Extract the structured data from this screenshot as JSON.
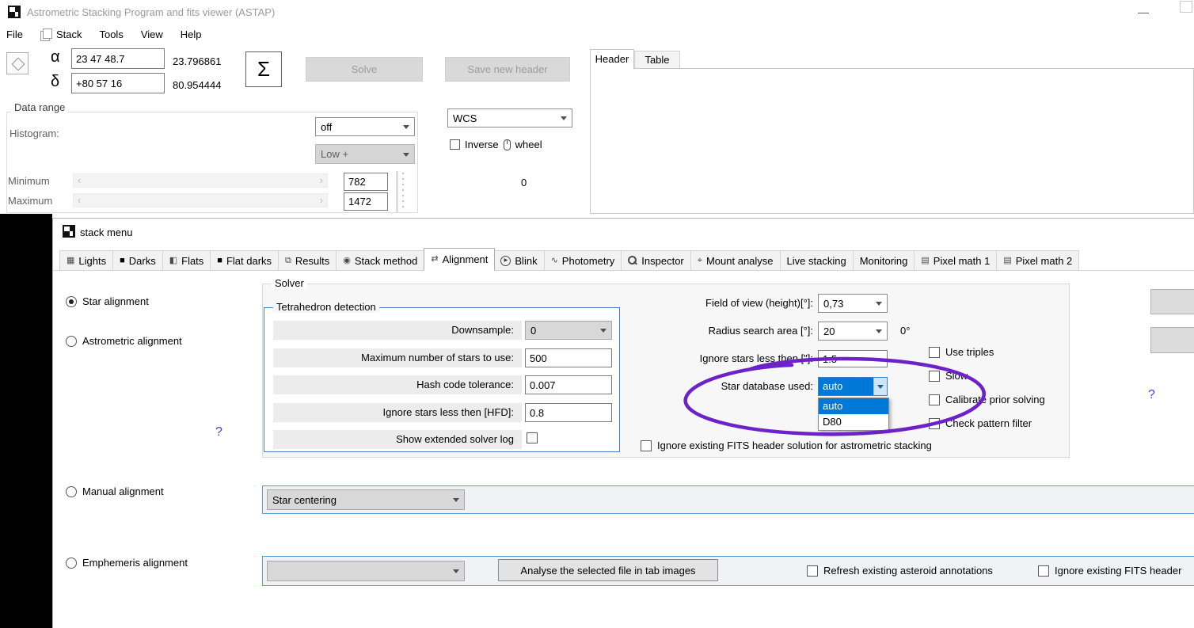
{
  "window": {
    "title": "Astrometric Stacking Program and fits viewer (ASTAP)",
    "minimize_glyph": "—"
  },
  "colors": {
    "selection_highlight": "#0078d7",
    "annotation_marker": "#6d21c9"
  },
  "menu": {
    "items": [
      "File",
      "Stack",
      "Tools",
      "View",
      "Help"
    ]
  },
  "toolbar": {
    "alpha_symbol": "α",
    "alpha_hms": "23 47 48.7",
    "alpha_deg": "23.796861",
    "delta_symbol": "δ",
    "delta_dms": "+80 57 16",
    "delta_deg": "80.954444",
    "sigma_label": "Σ",
    "solve_label": "Solve",
    "save_header_label": "Save new header"
  },
  "viewer": {
    "header_tab": "Header",
    "table_tab": "Table"
  },
  "data_range": {
    "group_label": "Data range",
    "histogram_label": "Histogram:",
    "stretch_value": "off",
    "range_value": "Low +",
    "wcs_value": "WCS",
    "inverse_pre": "Inverse",
    "inverse_post": "wheel",
    "minimum_label": "Minimum",
    "maximum_label": "Maximum",
    "minimum_value": "782",
    "maximum_value": "1472",
    "display_zero": "0"
  },
  "stack": {
    "title": "stack menu",
    "active_tab": "Alignment",
    "tabs": [
      {
        "label": "Lights",
        "icon": "grid-icon"
      },
      {
        "label": "Darks",
        "icon": "dark-frame-icon"
      },
      {
        "label": "Flats",
        "icon": "flat-frame-icon"
      },
      {
        "label": "Flat darks",
        "icon": "flat-dark-frame-icon"
      },
      {
        "label": "Results",
        "icon": "results-pages-icon"
      },
      {
        "label": "Stack method",
        "icon": "stack-method-icon"
      },
      {
        "label": "Alignment",
        "icon": "alignment-arrows-icon"
      },
      {
        "label": "Blink",
        "icon": "play-circle-icon"
      },
      {
        "label": "Photometry",
        "icon": "photometry-curve-icon"
      },
      {
        "label": "Inspector",
        "icon": "magnifier-icon"
      },
      {
        "label": "Mount analyse",
        "icon": "mount-analyse-icon"
      },
      {
        "label": "Live stacking",
        "icon": null
      },
      {
        "label": "Monitoring",
        "icon": null
      },
      {
        "label": "Pixel math 1",
        "icon": "pixel-math-icon"
      },
      {
        "label": "Pixel math 2",
        "icon": "pixel-math-icon"
      }
    ],
    "radios": [
      {
        "label": "Star alignment",
        "selected": true
      },
      {
        "label": "Astrometric alignment",
        "selected": false
      },
      {
        "label": "Manual alignment",
        "selected": false
      },
      {
        "label": "Emphemeris alignment",
        "selected": false
      }
    ],
    "help_glyph": "?",
    "solver": {
      "group_label": "Solver",
      "tetrahedron": {
        "group_label": "Tetrahedron detection",
        "downsample_label": "Downsample:",
        "downsample_value": "0",
        "max_stars_label": "Maximum number of stars to use:",
        "max_stars_value": "500",
        "hash_label": "Hash code tolerance:",
        "hash_value": "0.007",
        "hfd_label": "Ignore stars less then [HFD]:",
        "hfd_value": "0.8",
        "extended_log_label": "Show extended solver log"
      },
      "fov_label": "Field of view (height)[°]:",
      "fov_value": "0,73",
      "radius_label": "Radius search area  [°]:",
      "radius_value": "20",
      "radius_readout": "0°",
      "min_star_size_label": "Ignore stars less then [\"]:",
      "min_star_size_value": "1.5",
      "database_label": "Star database used:",
      "database_value": "auto",
      "database_options": [
        "auto",
        "D80"
      ],
      "use_triples_label": "Use triples",
      "slow_label": "Slow",
      "calibrate_label": "Calibrate prior solving",
      "pattern_label": "Check pattern filter",
      "ignore_fits_label": "Ignore existing FITS header solution for astrometric stacking"
    },
    "manual": {
      "combo_value": "Star centering"
    },
    "ephemeris": {
      "analyse_button_label": "Analyse the selected file in tab images",
      "refresh_label": "Refresh existing asteroid annotations",
      "ignore_header_label": "Ignore existing FITS header"
    }
  }
}
